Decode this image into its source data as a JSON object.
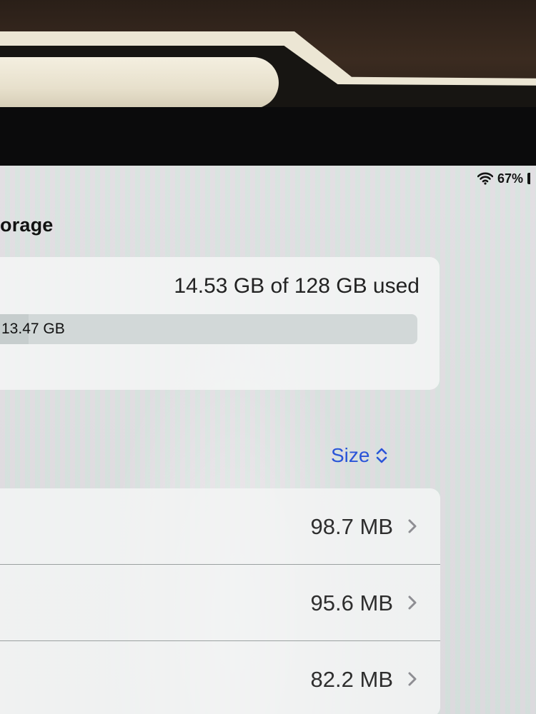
{
  "status_bar": {
    "battery_percent": "67%",
    "wifi_icon": "wifi-icon"
  },
  "header": {
    "title": "orage"
  },
  "storage": {
    "used_summary": "14.53 GB of 128 GB used",
    "bar_label": "13.47 GB",
    "used_fraction": 0.1135
  },
  "sort": {
    "label": "Size",
    "icon": "sort-chevrons-icon",
    "accent_color": "#2a55d8"
  },
  "apps": [
    {
      "size": "98.7 MB"
    },
    {
      "size": "95.6 MB"
    },
    {
      "size": "82.2 MB"
    }
  ]
}
